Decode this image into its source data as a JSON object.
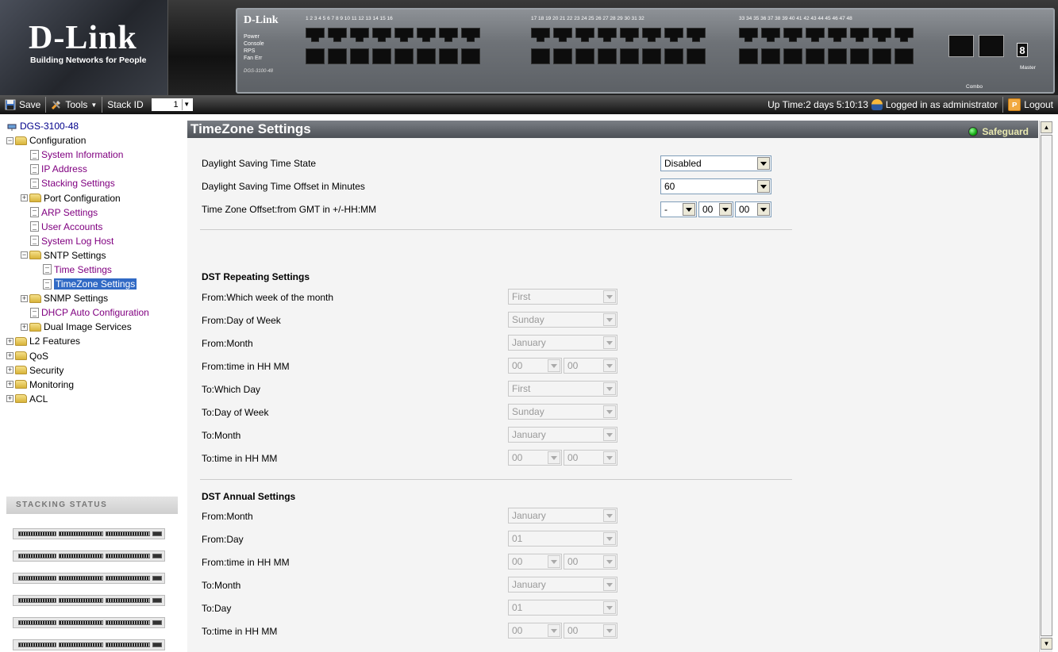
{
  "banner": {
    "brand": "D-Link",
    "tagline": "Building Networks for People",
    "panel_brand": "D-Link",
    "panel_leds": [
      "Power",
      "Console",
      "RPS",
      "Fan Err"
    ],
    "panel_model": "DGS-3100-48",
    "port_numbers_1": "1  2  3  4  5  6  7  8  9  10  11  12  13  14  15  16",
    "port_numbers_2": "17  18  19  20  21  22  23  24  25  26  27  28  29  30  31  32",
    "port_numbers_3": "33  34  35  36  37  38  39  40  41  42  43  44  45  46  47  48",
    "combo_label": "Combo",
    "master_label": "Master"
  },
  "toolbar": {
    "save_label": "Save",
    "tools_label": "Tools",
    "stackid_label": "Stack ID",
    "stackid_value": "1",
    "uptime": "Up Time:2 days 5:10:13",
    "logged_in": "Logged in as administrator",
    "logout_label": "Logout"
  },
  "tree": {
    "root": "DGS-3100-48",
    "configuration": "Configuration",
    "system_information": "System Information",
    "ip_address": "IP Address",
    "stacking_settings": "Stacking Settings",
    "port_configuration": "Port Configuration",
    "arp_settings": "ARP Settings",
    "user_accounts": "User Accounts",
    "system_log_host": "System Log Host",
    "sntp_settings": "SNTP Settings",
    "time_settings": "Time Settings",
    "timezone_settings": "TimeZone Settings",
    "snmp_settings": "SNMP Settings",
    "dhcp_auto": "DHCP Auto Configuration",
    "dual_image": "Dual Image Services",
    "l2_features": "L2 Features",
    "qos": "QoS",
    "security": "Security",
    "monitoring": "Monitoring",
    "acl": "ACL"
  },
  "stacking_status": {
    "title": "Stacking Status"
  },
  "page": {
    "title": "TimeZone Settings",
    "safeguard": "Safeguard"
  },
  "general": {
    "dst_state_label": "Daylight Saving Time State",
    "dst_state_value": "Disabled",
    "dst_offset_label": "Daylight Saving Time Offset in Minutes",
    "dst_offset_value": "60",
    "tz_offset_label": "Time Zone Offset:from GMT in +/-HH:MM",
    "tz_sign": "-",
    "tz_hh": "00",
    "tz_mm": "00"
  },
  "repeating": {
    "header": "DST Repeating Settings",
    "from_week_label": "From:Which week of the month",
    "from_week_value": "First",
    "from_dow_label": "From:Day of Week",
    "from_dow_value": "Sunday",
    "from_month_label": "From:Month",
    "from_month_value": "January",
    "from_time_label": "From:time in HH MM",
    "from_time_hh": "00",
    "from_time_mm": "00",
    "to_day_label": "To:Which Day",
    "to_day_value": "First",
    "to_dow_label": "To:Day of Week",
    "to_dow_value": "Sunday",
    "to_month_label": "To:Month",
    "to_month_value": "January",
    "to_time_label": "To:time in HH MM",
    "to_time_hh": "00",
    "to_time_mm": "00"
  },
  "annual": {
    "header": "DST Annual Settings",
    "from_month_label": "From:Month",
    "from_month_value": "January",
    "from_day_label": "From:Day",
    "from_day_value": "01",
    "from_time_label": "From:time in HH MM",
    "from_time_hh": "00",
    "from_time_mm": "00",
    "to_month_label": "To:Month",
    "to_month_value": "January",
    "to_day_label": "To:Day",
    "to_day_value": "01",
    "to_time_label": "To:time in HH MM",
    "to_time_hh": "00",
    "to_time_mm": "00"
  }
}
